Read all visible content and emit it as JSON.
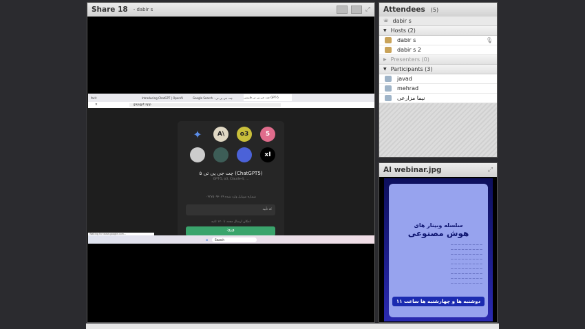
{
  "share": {
    "title": "Share 18",
    "presenter": "- dabir s",
    "browser": {
      "tabs": [
        "farit",
        "Introducing ChatGPT | OpenAI",
        "Google Search - چت جی پی تی",
        "چت جی پی تی فارسی GPT-5"
      ],
      "url": "gapgpt.app",
      "card": {
        "title": "چت جی پی تی ۵ (ChatGPT5)",
        "subtitle": "GPT-5, o3, Claude-4, ...",
        "phone_note": "شماره موبایل وارد شده ۰۹۳۷۵۰۹۲۰۷۹",
        "code_label": "کد تأیید",
        "resend": "امکان ارسال مجدد تا ۱۲۰ ثانیه",
        "submit": "ورود"
      },
      "status": "Waiting for www.google.com...",
      "taskbar_search": "Search"
    }
  },
  "attendees": {
    "title": "Attendees",
    "count": "(5)",
    "me": "dabir s",
    "groups": [
      {
        "label": "Hosts (2)",
        "members": [
          "dabir s",
          "dabir s 2"
        ]
      },
      {
        "label": "Presenters (0)",
        "members": []
      },
      {
        "label": "Participants (3)",
        "members": [
          "javad",
          "mehrad",
          "نیما مزارعی"
        ]
      }
    ]
  },
  "file_pod": {
    "title": "AI webinar.jpg",
    "poster": {
      "title1": "سلسله وبینار های",
      "title2": "هوش مصنوعی",
      "footer": "دوشنبه ها و چهارشنبه ها ساعت ۱۱"
    }
  }
}
